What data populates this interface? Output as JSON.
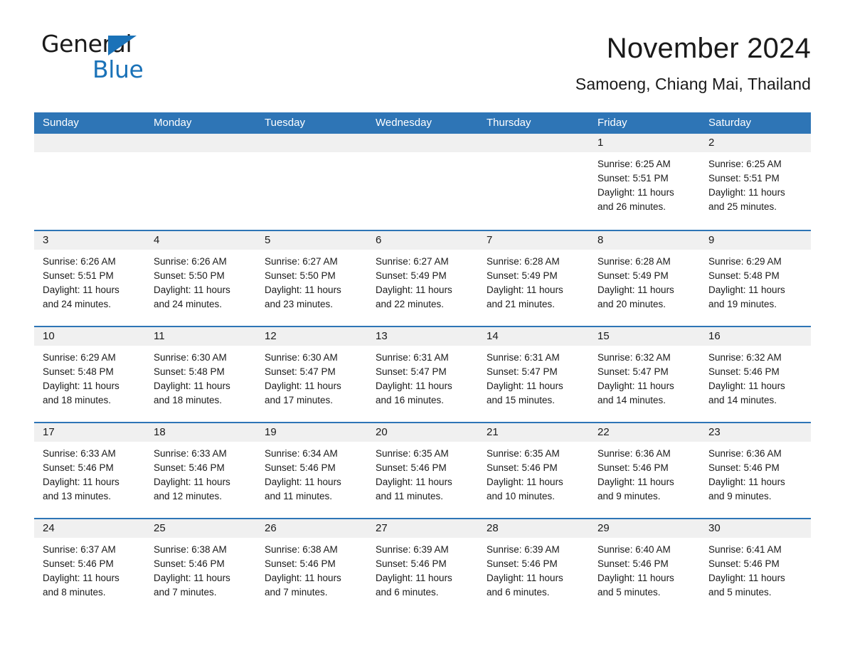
{
  "brand": {
    "name_part1": "General",
    "name_part2": "Blue",
    "accent_color": "#1a72b8"
  },
  "header": {
    "month_title": "November 2024",
    "location": "Samoeng, Chiang Mai, Thailand"
  },
  "theme": {
    "header_blue": "#2e75b6",
    "daynum_band": "#f0f0f0",
    "text": "#1a1a1a"
  },
  "weekday_headers": [
    "Sunday",
    "Monday",
    "Tuesday",
    "Wednesday",
    "Thursday",
    "Friday",
    "Saturday"
  ],
  "weeks": [
    [
      {
        "day": "",
        "lines": [
          "",
          "",
          "",
          ""
        ]
      },
      {
        "day": "",
        "lines": [
          "",
          "",
          "",
          ""
        ]
      },
      {
        "day": "",
        "lines": [
          "",
          "",
          "",
          ""
        ]
      },
      {
        "day": "",
        "lines": [
          "",
          "",
          "",
          ""
        ]
      },
      {
        "day": "",
        "lines": [
          "",
          "",
          "",
          ""
        ]
      },
      {
        "day": "1",
        "lines": [
          "Sunrise: 6:25 AM",
          "Sunset: 5:51 PM",
          "Daylight: 11 hours",
          "and 26 minutes."
        ]
      },
      {
        "day": "2",
        "lines": [
          "Sunrise: 6:25 AM",
          "Sunset: 5:51 PM",
          "Daylight: 11 hours",
          "and 25 minutes."
        ]
      }
    ],
    [
      {
        "day": "3",
        "lines": [
          "Sunrise: 6:26 AM",
          "Sunset: 5:51 PM",
          "Daylight: 11 hours",
          "and 24 minutes."
        ]
      },
      {
        "day": "4",
        "lines": [
          "Sunrise: 6:26 AM",
          "Sunset: 5:50 PM",
          "Daylight: 11 hours",
          "and 24 minutes."
        ]
      },
      {
        "day": "5",
        "lines": [
          "Sunrise: 6:27 AM",
          "Sunset: 5:50 PM",
          "Daylight: 11 hours",
          "and 23 minutes."
        ]
      },
      {
        "day": "6",
        "lines": [
          "Sunrise: 6:27 AM",
          "Sunset: 5:49 PM",
          "Daylight: 11 hours",
          "and 22 minutes."
        ]
      },
      {
        "day": "7",
        "lines": [
          "Sunrise: 6:28 AM",
          "Sunset: 5:49 PM",
          "Daylight: 11 hours",
          "and 21 minutes."
        ]
      },
      {
        "day": "8",
        "lines": [
          "Sunrise: 6:28 AM",
          "Sunset: 5:49 PM",
          "Daylight: 11 hours",
          "and 20 minutes."
        ]
      },
      {
        "day": "9",
        "lines": [
          "Sunrise: 6:29 AM",
          "Sunset: 5:48 PM",
          "Daylight: 11 hours",
          "and 19 minutes."
        ]
      }
    ],
    [
      {
        "day": "10",
        "lines": [
          "Sunrise: 6:29 AM",
          "Sunset: 5:48 PM",
          "Daylight: 11 hours",
          "and 18 minutes."
        ]
      },
      {
        "day": "11",
        "lines": [
          "Sunrise: 6:30 AM",
          "Sunset: 5:48 PM",
          "Daylight: 11 hours",
          "and 18 minutes."
        ]
      },
      {
        "day": "12",
        "lines": [
          "Sunrise: 6:30 AM",
          "Sunset: 5:47 PM",
          "Daylight: 11 hours",
          "and 17 minutes."
        ]
      },
      {
        "day": "13",
        "lines": [
          "Sunrise: 6:31 AM",
          "Sunset: 5:47 PM",
          "Daylight: 11 hours",
          "and 16 minutes."
        ]
      },
      {
        "day": "14",
        "lines": [
          "Sunrise: 6:31 AM",
          "Sunset: 5:47 PM",
          "Daylight: 11 hours",
          "and 15 minutes."
        ]
      },
      {
        "day": "15",
        "lines": [
          "Sunrise: 6:32 AM",
          "Sunset: 5:47 PM",
          "Daylight: 11 hours",
          "and 14 minutes."
        ]
      },
      {
        "day": "16",
        "lines": [
          "Sunrise: 6:32 AM",
          "Sunset: 5:46 PM",
          "Daylight: 11 hours",
          "and 14 minutes."
        ]
      }
    ],
    [
      {
        "day": "17",
        "lines": [
          "Sunrise: 6:33 AM",
          "Sunset: 5:46 PM",
          "Daylight: 11 hours",
          "and 13 minutes."
        ]
      },
      {
        "day": "18",
        "lines": [
          "Sunrise: 6:33 AM",
          "Sunset: 5:46 PM",
          "Daylight: 11 hours",
          "and 12 minutes."
        ]
      },
      {
        "day": "19",
        "lines": [
          "Sunrise: 6:34 AM",
          "Sunset: 5:46 PM",
          "Daylight: 11 hours",
          "and 11 minutes."
        ]
      },
      {
        "day": "20",
        "lines": [
          "Sunrise: 6:35 AM",
          "Sunset: 5:46 PM",
          "Daylight: 11 hours",
          "and 11 minutes."
        ]
      },
      {
        "day": "21",
        "lines": [
          "Sunrise: 6:35 AM",
          "Sunset: 5:46 PM",
          "Daylight: 11 hours",
          "and 10 minutes."
        ]
      },
      {
        "day": "22",
        "lines": [
          "Sunrise: 6:36 AM",
          "Sunset: 5:46 PM",
          "Daylight: 11 hours",
          "and 9 minutes."
        ]
      },
      {
        "day": "23",
        "lines": [
          "Sunrise: 6:36 AM",
          "Sunset: 5:46 PM",
          "Daylight: 11 hours",
          "and 9 minutes."
        ]
      }
    ],
    [
      {
        "day": "24",
        "lines": [
          "Sunrise: 6:37 AM",
          "Sunset: 5:46 PM",
          "Daylight: 11 hours",
          "and 8 minutes."
        ]
      },
      {
        "day": "25",
        "lines": [
          "Sunrise: 6:38 AM",
          "Sunset: 5:46 PM",
          "Daylight: 11 hours",
          "and 7 minutes."
        ]
      },
      {
        "day": "26",
        "lines": [
          "Sunrise: 6:38 AM",
          "Sunset: 5:46 PM",
          "Daylight: 11 hours",
          "and 7 minutes."
        ]
      },
      {
        "day": "27",
        "lines": [
          "Sunrise: 6:39 AM",
          "Sunset: 5:46 PM",
          "Daylight: 11 hours",
          "and 6 minutes."
        ]
      },
      {
        "day": "28",
        "lines": [
          "Sunrise: 6:39 AM",
          "Sunset: 5:46 PM",
          "Daylight: 11 hours",
          "and 6 minutes."
        ]
      },
      {
        "day": "29",
        "lines": [
          "Sunrise: 6:40 AM",
          "Sunset: 5:46 PM",
          "Daylight: 11 hours",
          "and 5 minutes."
        ]
      },
      {
        "day": "30",
        "lines": [
          "Sunrise: 6:41 AM",
          "Sunset: 5:46 PM",
          "Daylight: 11 hours",
          "and 5 minutes."
        ]
      }
    ]
  ]
}
